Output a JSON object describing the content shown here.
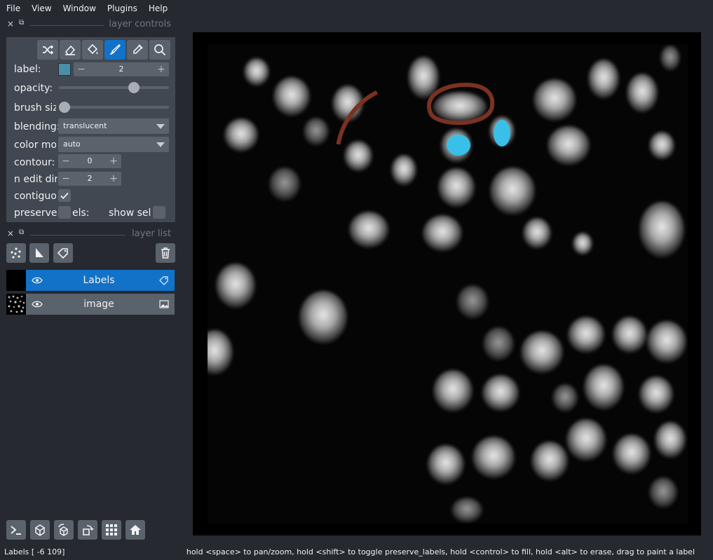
{
  "menu": [
    "File",
    "View",
    "Window",
    "Plugins",
    "Help"
  ],
  "docks": {
    "controls_title": "layer controls",
    "list_title": "layer list",
    "close_glyph": "×",
    "float_glyph": "⧉"
  },
  "controls": {
    "label": {
      "text": "label:",
      "value": "2",
      "color": "#4a8fa6"
    },
    "opacity": {
      "text": "opacity:",
      "level": 0.7
    },
    "brush": {
      "text": "brush siz",
      "level": 0.0
    },
    "blending": {
      "text": "blending:",
      "value": "translucent"
    },
    "color_mode": {
      "text": "color moo",
      "value": "auto"
    },
    "contour": {
      "text": "contour:",
      "value": "0"
    },
    "n_edit_dim": {
      "text": "n edit dim",
      "value": "2"
    },
    "contiguous": {
      "text": "contiguou",
      "checked": true
    },
    "preserve": {
      "text": "preserve l",
      "text2": "els:",
      "checked": false
    },
    "show_sel": {
      "text": "show sele",
      "checked": false
    },
    "tools": [
      {
        "name": "shuffle-colors",
        "active": false
      },
      {
        "name": "erase",
        "active": false
      },
      {
        "name": "fill",
        "active": false
      },
      {
        "name": "paint",
        "active": true
      },
      {
        "name": "pick",
        "active": false
      },
      {
        "name": "pan-zoom",
        "active": false
      }
    ]
  },
  "layers": [
    {
      "name": "Labels",
      "selected": true,
      "icon": "label-icon"
    },
    {
      "name": "image",
      "selected": false,
      "icon": "image-icon"
    }
  ],
  "status": {
    "left": "Labels [ -6 109]",
    "right": "hold <space> to pan/zoom, hold <shift> to toggle preserve_labels, hold <control> to fill, hold <alt> to erase, drag to paint a label"
  },
  "colors": {
    "accent": "#1172c8",
    "panel": "#414851",
    "background": "#262930",
    "stroke_label": "#7a3220",
    "paint_label": "#38c0e8"
  }
}
